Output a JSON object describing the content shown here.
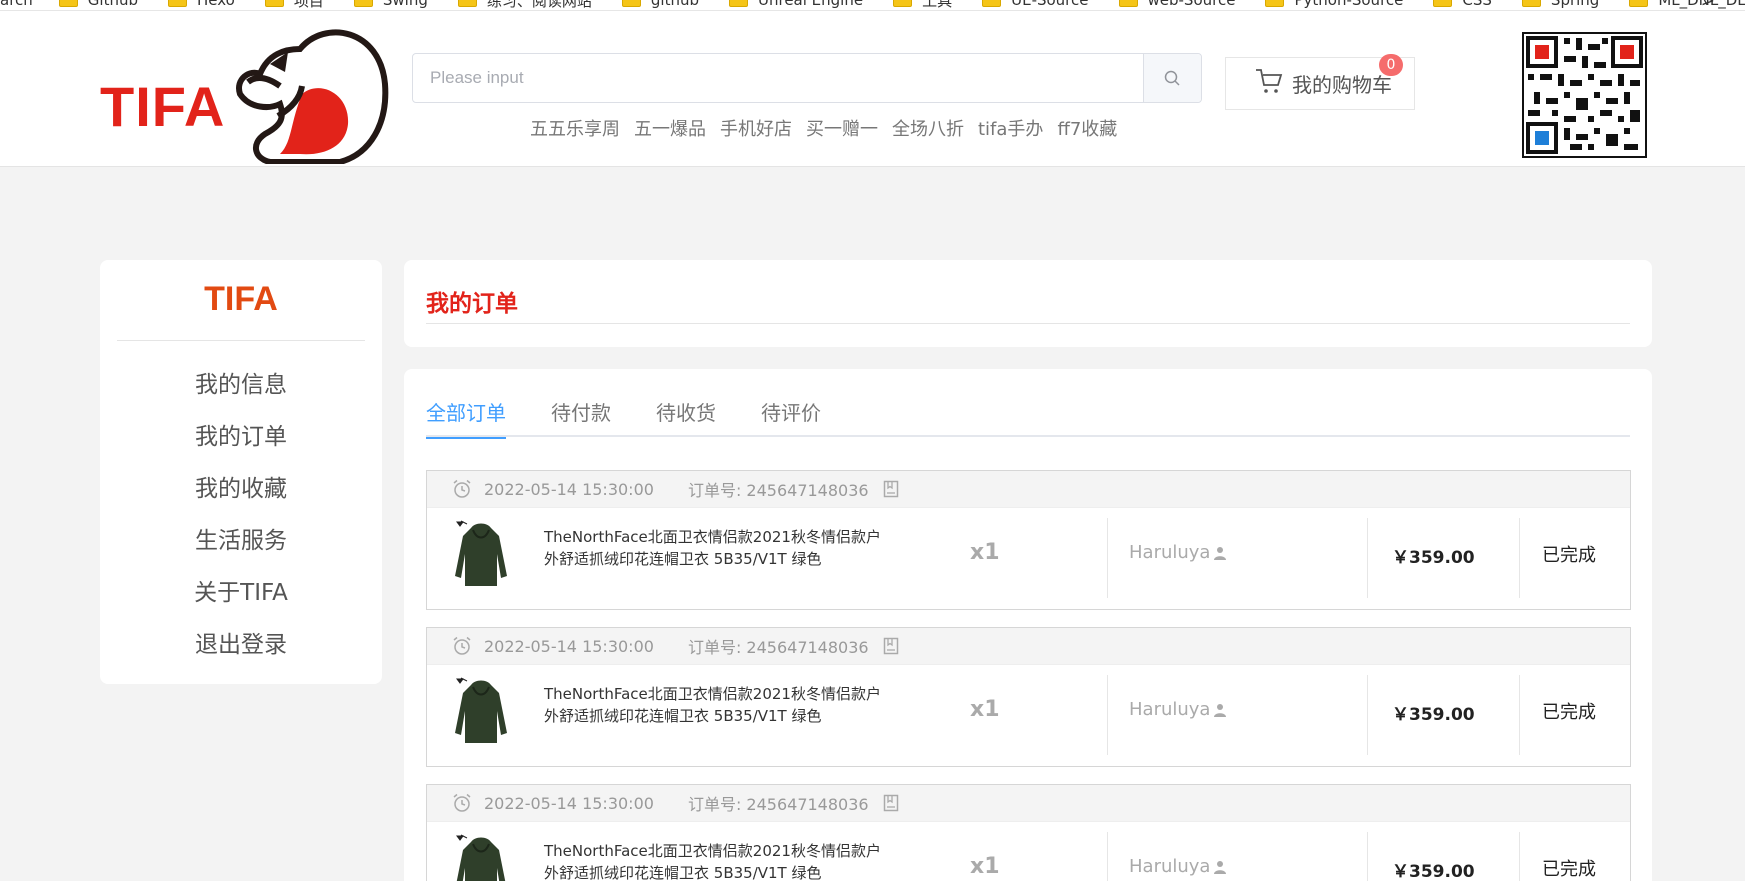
{
  "bookmarks": {
    "items": [
      "arch",
      "Github",
      "Hexo",
      "项目",
      "Swing",
      "练习、阅读网站",
      "github",
      "Unreal Engine",
      "工具",
      "UE-Source",
      "web-Source",
      "Python-Source",
      "CSS",
      "Spring",
      "ML_DNL_DL"
    ],
    "more": ">"
  },
  "header": {
    "logo_text": "TIFA",
    "search_placeholder": "Please input",
    "hot_tags": [
      "五五乐享周",
      "五一爆品",
      "手机好店",
      "买一赠一",
      "全场八折",
      "tifa手办",
      "ff7收藏"
    ],
    "cart_label": "我的购物车",
    "cart_count": "0"
  },
  "sidebar": {
    "brand": "TIFA",
    "items": [
      "我的信息",
      "我的订单",
      "我的收藏",
      "生活服务",
      "关于TIFA",
      "退出登录"
    ]
  },
  "main": {
    "title": "我的订单",
    "tabs": [
      "全部订单",
      "待付款",
      "待收货",
      "待评价"
    ],
    "active_tab": "全部订单"
  },
  "orders": [
    {
      "date": "2022-05-14 15:30:00",
      "order_no": "订单号: 245647148036",
      "product_line1": "TheNorthFace北面卫衣情侣款2021秋冬情侣款户",
      "product_line2": "外舒适抓绒印花连帽卫衣 5B35/V1T 绿色",
      "qty": "x1",
      "user": "Haruluya",
      "price": "￥359.00",
      "status": "已完成"
    },
    {
      "date": "2022-05-14 15:30:00",
      "order_no": "订单号: 245647148036",
      "product_line1": "TheNorthFace北面卫衣情侣款2021秋冬情侣款户",
      "product_line2": "外舒适抓绒印花连帽卫衣 5B35/V1T 绿色",
      "qty": "x1",
      "user": "Haruluya",
      "price": "￥359.00",
      "status": "已完成"
    },
    {
      "date": "2022-05-14 15:30:00",
      "order_no": "订单号: 245647148036",
      "product_line1": "TheNorthFace北面卫衣情侣款2021秋冬情侣款户",
      "product_line2": "外舒适抓绒印花连帽卫衣 5B35/V1T 绿色",
      "qty": "x1",
      "user": "Haruluya",
      "price": "￥359.00",
      "status": "已完成"
    }
  ],
  "colors": {
    "brand_red": "#e2231a",
    "tab_active": "#409eff",
    "badge": "#f56c6c"
  }
}
